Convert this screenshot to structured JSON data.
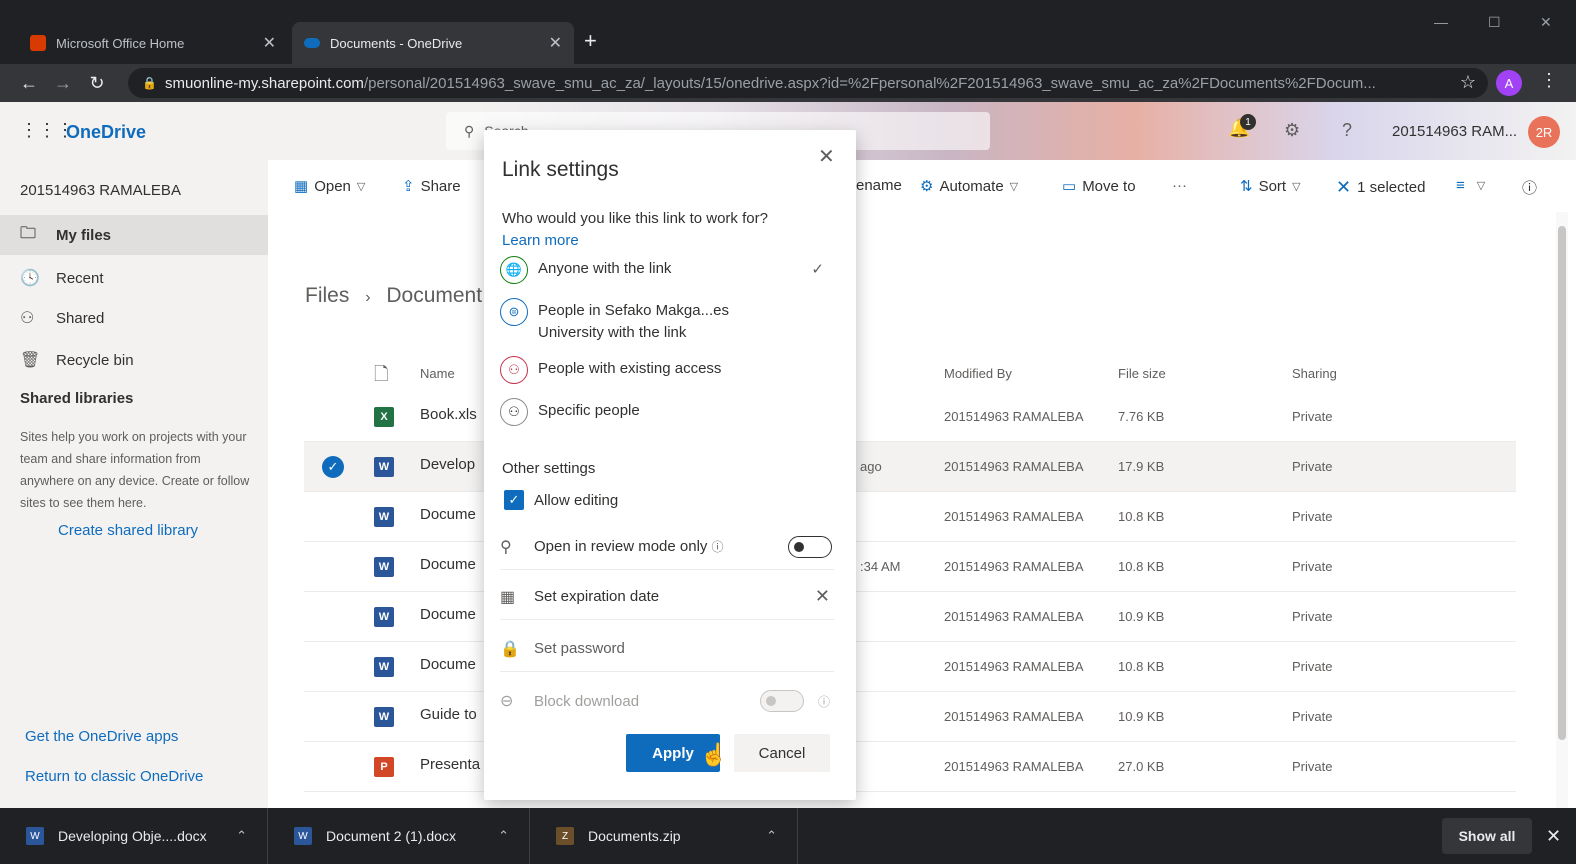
{
  "browser": {
    "tabs": [
      {
        "title": "Microsoft Office Home",
        "active": false,
        "favicon_color": "#d83b01"
      },
      {
        "title": "Documents - OneDrive",
        "active": true,
        "favicon_color": "#0f6cbd"
      }
    ],
    "new_tab": "+",
    "url_domain": "smuonline-my.sharepoint.com",
    "url_path": "/personal/201514963_swave_smu_ac_za/_layouts/15/onedrive.aspx?id=%2Fpersonal%2F201514963_swave_smu_ac_za%2FDocuments%2FDocum...",
    "profile_initial": "A"
  },
  "header": {
    "app_name": "OneDrive",
    "search_placeholder": "Search",
    "notification_count": "1",
    "user_name": "201514963 RAM...",
    "user_initials": "2R"
  },
  "sidebar": {
    "account": "201514963 RAMALEBA",
    "items": [
      {
        "label": "My files",
        "icon": "folder-icon",
        "selected": true
      },
      {
        "label": "Recent",
        "icon": "clock-icon"
      },
      {
        "label": "Shared",
        "icon": "people-icon"
      },
      {
        "label": "Recycle bin",
        "icon": "recycle-bin-icon"
      }
    ],
    "section_title": "Shared libraries",
    "section_desc": "Sites help you work on projects with your team and share information from anywhere on any device. Create or follow sites to see them here.",
    "create_library": "Create shared library",
    "get_apps": "Get the OneDrive apps",
    "return_classic": "Return to classic OneDrive"
  },
  "commandbar": {
    "open": "Open",
    "share": "Share",
    "rename": "ename",
    "automate": "Automate",
    "move_to": "Move to",
    "more": "···",
    "sort": "Sort",
    "selected": "1 selected"
  },
  "breadcrumb": {
    "root": "Files",
    "current": "Document"
  },
  "table": {
    "headers": {
      "name": "Name",
      "modified_by": "Modified By",
      "file_size": "File size",
      "sharing": "Sharing"
    },
    "rows": [
      {
        "name": "Book.xls",
        "type": "excel",
        "modified": "",
        "modified_by": "201514963 RAMALEBA",
        "size": "7.76 KB",
        "sharing": "Private",
        "selected": false
      },
      {
        "name": "Develop",
        "type": "word",
        "modified": "ago",
        "modified_by": "201514963 RAMALEBA",
        "size": "17.9 KB",
        "sharing": "Private",
        "selected": true
      },
      {
        "name": "Docume",
        "type": "word",
        "modified": "",
        "modified_by": "201514963 RAMALEBA",
        "size": "10.8 KB",
        "sharing": "Private",
        "selected": false
      },
      {
        "name": "Docume",
        "type": "word",
        "modified": ":34 AM",
        "modified_by": "201514963 RAMALEBA",
        "size": "10.8 KB",
        "sharing": "Private",
        "selected": false
      },
      {
        "name": "Docume",
        "type": "word",
        "modified": "",
        "modified_by": "201514963 RAMALEBA",
        "size": "10.9 KB",
        "sharing": "Private",
        "selected": false
      },
      {
        "name": "Docume",
        "type": "word",
        "modified": "",
        "modified_by": "201514963 RAMALEBA",
        "size": "10.8 KB",
        "sharing": "Private",
        "selected": false
      },
      {
        "name": "Guide to",
        "type": "word",
        "modified": "",
        "modified_by": "201514963 RAMALEBA",
        "size": "10.9 KB",
        "sharing": "Private",
        "selected": false
      },
      {
        "name": "Presenta",
        "type": "ppt",
        "modified": "",
        "modified_by": "201514963 RAMALEBA",
        "size": "27.0 KB",
        "sharing": "Private",
        "selected": false
      }
    ]
  },
  "dialog": {
    "title": "Link settings",
    "question": "Who would you like this link to work for?",
    "learn_more": "Learn more",
    "options": [
      {
        "label": "Anyone with the link",
        "icon": "globe-icon",
        "checked": true
      },
      {
        "label": "People in Sefako Makga...es University with the link",
        "icon": "organization-icon",
        "checked": false
      },
      {
        "label": "People with existing access",
        "icon": "existing-access-icon",
        "checked": false
      },
      {
        "label": "Specific people",
        "icon": "specific-people-icon",
        "checked": false
      }
    ],
    "other_settings": "Other settings",
    "allow_editing": "Allow editing",
    "review_mode": "Open in review mode only",
    "expiration": "Set expiration date",
    "password": "Set password",
    "block_download": "Block download",
    "apply": "Apply",
    "cancel": "Cancel"
  },
  "downloads": {
    "items": [
      {
        "name": "Developing Obje....docx",
        "type": "word"
      },
      {
        "name": "Document 2 (1).docx",
        "type": "word"
      },
      {
        "name": "Documents.zip",
        "type": "zip"
      }
    ],
    "show_all": "Show all"
  }
}
